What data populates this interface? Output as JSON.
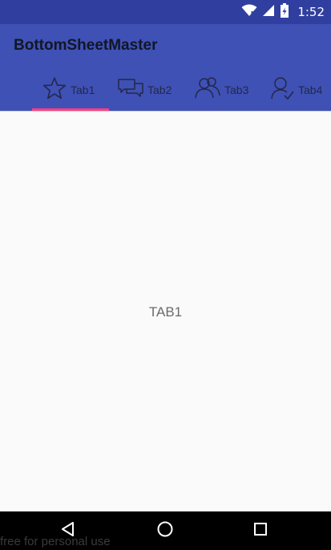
{
  "status_bar": {
    "time": "1:52",
    "icons": [
      "wifi-icon",
      "cell-signal-icon",
      "battery-icon"
    ]
  },
  "app_bar": {
    "title": "BottomSheetMaster"
  },
  "tabs": [
    {
      "label": "Tab1",
      "icon": "star-icon",
      "selected": true
    },
    {
      "label": "Tab2",
      "icon": "chat-icon",
      "selected": false
    },
    {
      "label": "Tab3",
      "icon": "group-icon",
      "selected": false
    },
    {
      "label": "Tab4",
      "icon": "person-check-icon",
      "selected": false
    }
  ],
  "content": {
    "text": "TAB1"
  },
  "nav_bar": {
    "buttons": [
      "back-icon",
      "home-icon",
      "recents-icon"
    ]
  },
  "watermark": {
    "text": "free for personal use"
  },
  "colors": {
    "status_bar": "#303F9F",
    "primary": "#3F51B5",
    "accent": "#FF4081",
    "background": "#FAFAFA"
  }
}
